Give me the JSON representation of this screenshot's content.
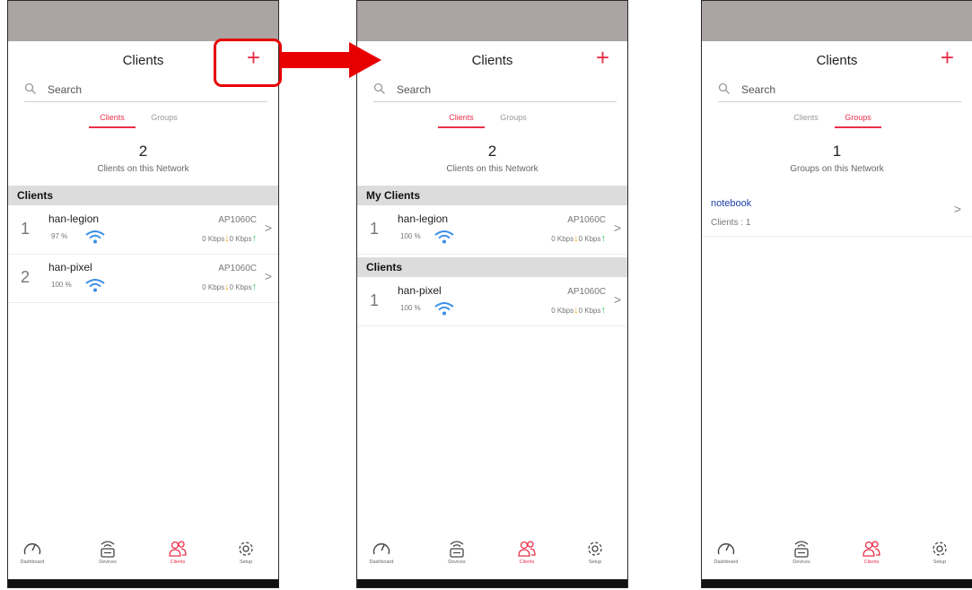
{
  "accent_color": "#e8304a",
  "header": {
    "title": "Clients",
    "add_label": "+"
  },
  "search": {
    "placeholder": "Search"
  },
  "tabs": {
    "clients": "Clients",
    "groups": "Groups"
  },
  "icons": {
    "search": "search-icon",
    "wifi": "wifi-icon",
    "chevron": "chevron-right-icon"
  },
  "nav": [
    {
      "label": "Dashboard",
      "icon": "speedometer-icon"
    },
    {
      "label": "Devices",
      "icon": "router-icon"
    },
    {
      "label": "Clients",
      "icon": "users-icon"
    },
    {
      "label": "Setup",
      "icon": "gear-icon"
    }
  ],
  "screens": [
    {
      "count": "2",
      "count_caption": "Clients on this Network",
      "sections": [
        {
          "title": "Clients",
          "rows": [
            {
              "index": "1",
              "name": "han-legion",
              "signal": "97 %",
              "ap": "AP1060C",
              "down": "0 Kbps",
              "up": "0 Kbps"
            },
            {
              "index": "2",
              "name": "han-pixel",
              "signal": "100 %",
              "ap": "AP1060C",
              "down": "0 Kbps",
              "up": "0 Kbps"
            }
          ]
        }
      ]
    },
    {
      "count": "2",
      "count_caption": "Clients on this Network",
      "sections": [
        {
          "title": "My Clients",
          "rows": [
            {
              "index": "1",
              "name": "han-legion",
              "signal": "100 %",
              "ap": "AP1060C",
              "down": "0 Kbps",
              "up": "0 Kbps"
            }
          ]
        },
        {
          "title": "Clients",
          "rows": [
            {
              "index": "1",
              "name": "han-pixel",
              "signal": "100 %",
              "ap": "AP1060C",
              "down": "0 Kbps",
              "up": "0 Kbps"
            }
          ]
        }
      ]
    },
    {
      "count": "1",
      "count_caption": "Groups on this Network",
      "group": {
        "name": "notebook",
        "clients": "Clients : 1"
      }
    }
  ]
}
